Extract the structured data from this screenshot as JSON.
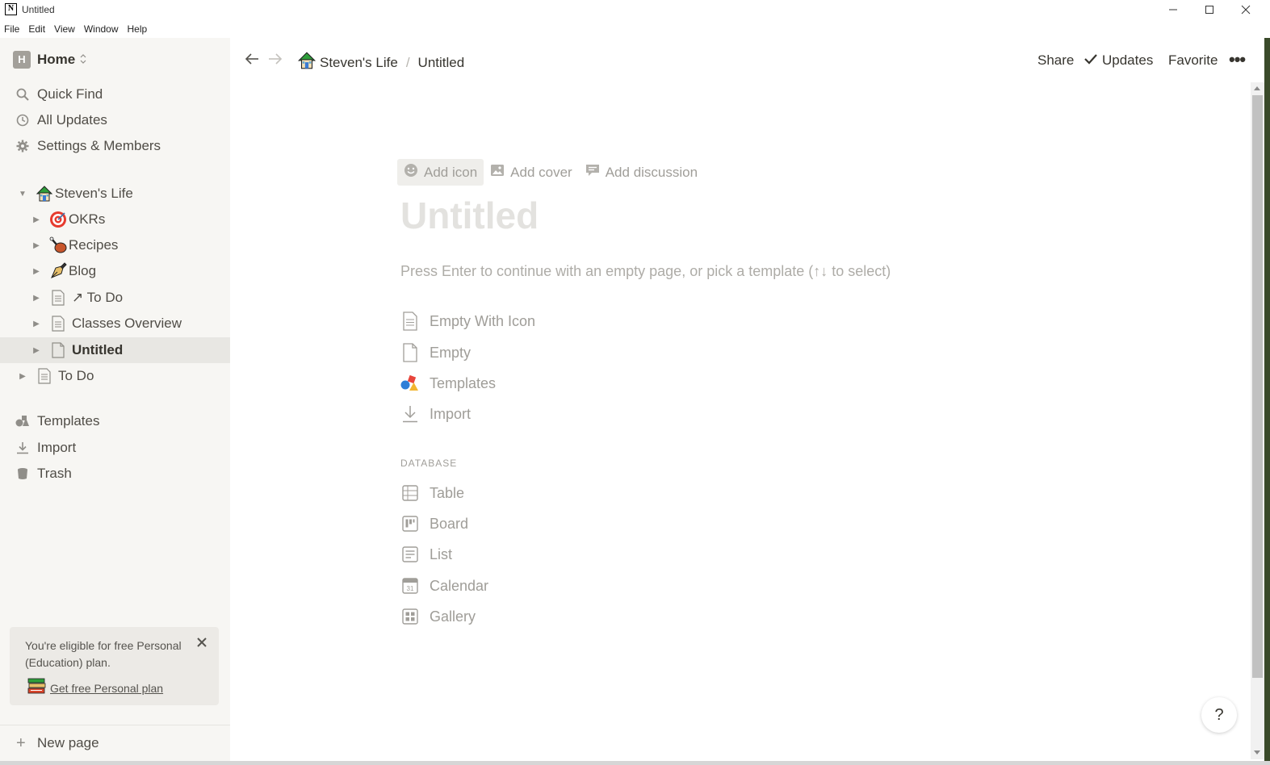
{
  "window": {
    "title": "Untitled",
    "logo": "N"
  },
  "menu": [
    "File",
    "Edit",
    "View",
    "Window",
    "Help"
  ],
  "sidebar": {
    "workspace": {
      "badge": "H",
      "name": "Home"
    },
    "nav": [
      {
        "label": "Quick Find",
        "icon": "search-icon"
      },
      {
        "label": "All Updates",
        "icon": "clock-icon"
      },
      {
        "label": "Settings & Members",
        "icon": "gear-icon"
      }
    ],
    "tree": {
      "root": "Steven's Life",
      "children": [
        "OKRs",
        "Recipes",
        "Blog",
        "↗ To Do",
        "Classes Overview",
        "Untitled"
      ],
      "sibling": "To Do"
    },
    "bottom_nav": [
      {
        "label": "Templates",
        "icon": "templates-icon"
      },
      {
        "label": "Import",
        "icon": "import-icon"
      },
      {
        "label": "Trash",
        "icon": "trash-icon"
      }
    ],
    "promo": {
      "text": "You're eligible for free Personal (Education) plan.",
      "link": "Get free Personal plan"
    },
    "new_page": "New page"
  },
  "topbar": {
    "breadcrumb": [
      "Steven's Life",
      "/",
      "Untitled"
    ],
    "share": "Share",
    "updates": "Updates",
    "favorite": "Favorite",
    "more": "•••"
  },
  "page": {
    "actions": [
      "Add icon",
      "Add cover",
      "Add discussion"
    ],
    "title_placeholder": "Untitled",
    "hint": "Press Enter to continue with an empty page, or pick a template (↑↓ to select)",
    "options": [
      "Empty With Icon",
      "Empty",
      "Templates",
      "Import"
    ],
    "database_label": "DATABASE",
    "database_options": [
      "Table",
      "Board",
      "List",
      "Calendar",
      "Gallery"
    ]
  },
  "help": "?"
}
